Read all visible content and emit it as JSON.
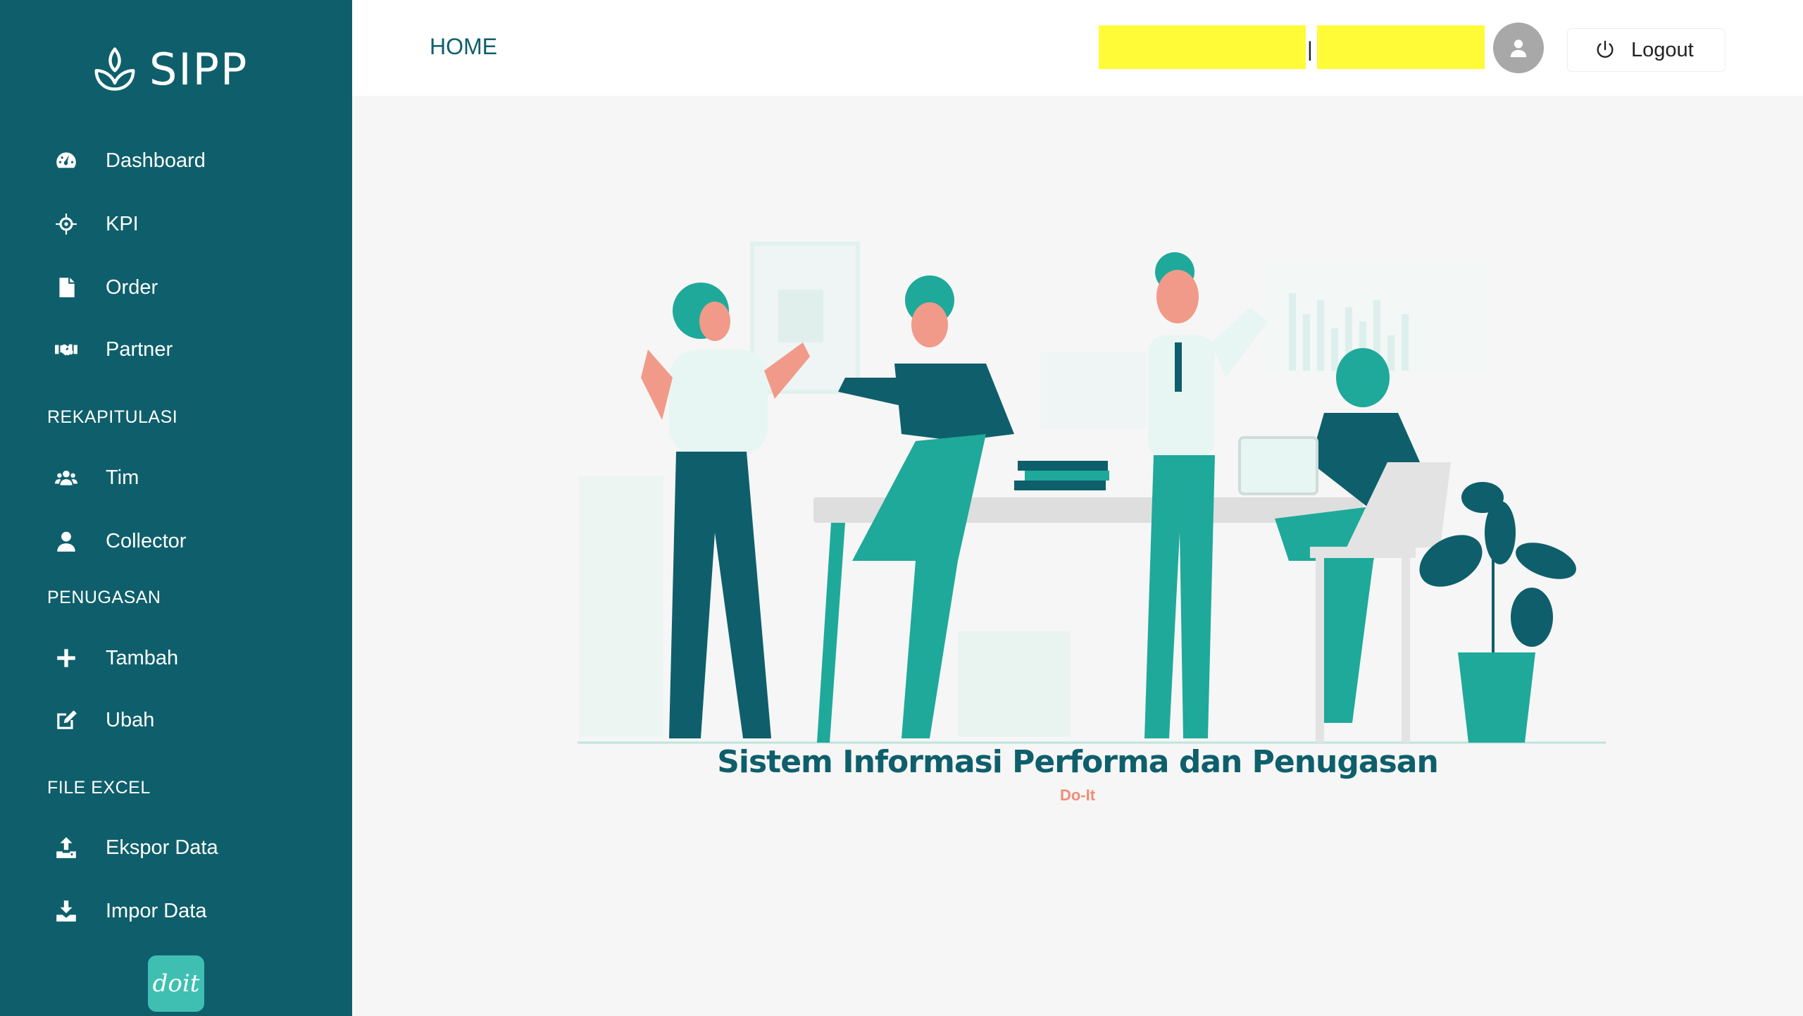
{
  "brand": {
    "name": "SIPP",
    "logo_icon": "leaf-logo-icon"
  },
  "sidebar": {
    "items": [
      {
        "label": "Dashboard",
        "icon": "dashboard-gauge-icon"
      },
      {
        "label": "KPI",
        "icon": "crosshairs-icon"
      },
      {
        "label": "Order",
        "icon": "file-icon"
      },
      {
        "label": "Partner",
        "icon": "handshake-icon"
      }
    ],
    "sections": [
      {
        "title": "REKAPITULASI",
        "items": [
          {
            "label": "Tim",
            "icon": "users-icon"
          },
          {
            "label": "Collector",
            "icon": "user-icon"
          }
        ]
      },
      {
        "title": "PENUGASAN",
        "items": [
          {
            "label": "Tambah",
            "icon": "plus-icon"
          },
          {
            "label": "Ubah",
            "icon": "edit-icon"
          }
        ]
      },
      {
        "title": "FILE EXCEL",
        "items": [
          {
            "label": "Ekspor Data",
            "icon": "upload-icon"
          },
          {
            "label": "Impor Data",
            "icon": "download-icon"
          }
        ]
      }
    ],
    "badge": "doit"
  },
  "header": {
    "title": "HOME",
    "separator": "|",
    "logout_label": "Logout",
    "highlight_color": "#fffb37"
  },
  "main": {
    "title": "Sistem Informasi Performa dan Penugasan",
    "subtitle": "Do-It"
  },
  "colors": {
    "primary": "#0e5f6b",
    "accent": "#1fa99a",
    "subtitle": "#f08c76",
    "background": "#f6f6f6"
  }
}
